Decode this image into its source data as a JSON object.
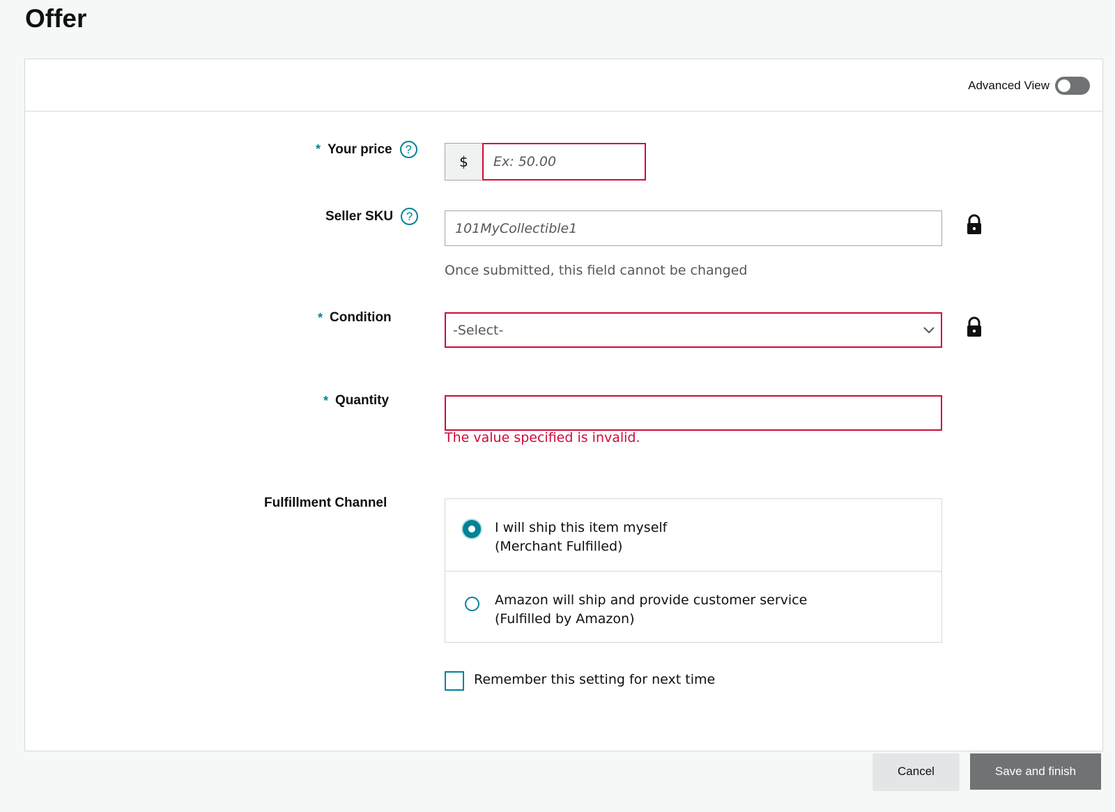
{
  "page": {
    "title": "Offer"
  },
  "header": {
    "advanced_view_label": "Advanced View",
    "advanced_view_on": false
  },
  "form": {
    "price": {
      "label": "Your price",
      "currency": "$",
      "placeholder": "Ex: 50.00",
      "value": ""
    },
    "sku": {
      "label": "Seller SKU",
      "placeholder": "101MyCollectible1",
      "hint": "Once submitted, this field cannot be changed"
    },
    "condition": {
      "label": "Condition",
      "selected": "-Select-"
    },
    "quantity": {
      "label": "Quantity",
      "value": "",
      "error": "The value specified is invalid."
    },
    "fulfillment": {
      "label": "Fulfillment Channel",
      "options": [
        {
          "line1": "I will ship this item myself",
          "line2": "(Merchant Fulfilled)",
          "selected": true
        },
        {
          "line1": "Amazon will ship and provide customer service",
          "line2": "(Fulfilled by Amazon)",
          "selected": false
        }
      ]
    },
    "remember": {
      "label": "Remember this setting for next time",
      "checked": false
    },
    "required_marker": "*"
  },
  "actions": {
    "cancel_label": "Cancel",
    "save_label": "Save and finish"
  },
  "colors": {
    "accent": "#008296",
    "error": "#cc0c39",
    "border": "#a6a6a6"
  }
}
